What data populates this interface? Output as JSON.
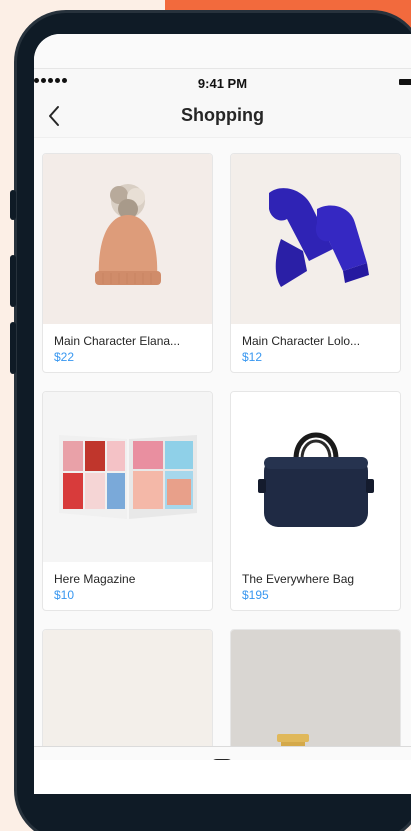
{
  "status": {
    "time": "9:41 PM"
  },
  "nav": {
    "title": "Shopping"
  },
  "products": [
    {
      "name": "Main Character Elana...",
      "price": "$22"
    },
    {
      "name": "Main Character Lolo...",
      "price": "$12"
    },
    {
      "name": "Here Magazine",
      "price": "$10"
    },
    {
      "name": "The Everywhere Bag",
      "price": "$195"
    },
    {
      "name": "",
      "price": ""
    },
    {
      "name": "",
      "price": ""
    }
  ],
  "tabs": [
    "home-icon",
    "search-icon",
    "add-icon",
    "heart-icon",
    "profile-icon"
  ],
  "colors": {
    "accent": "#3897f0",
    "background": "#fcefe6",
    "brand": "#f26a3d"
  }
}
